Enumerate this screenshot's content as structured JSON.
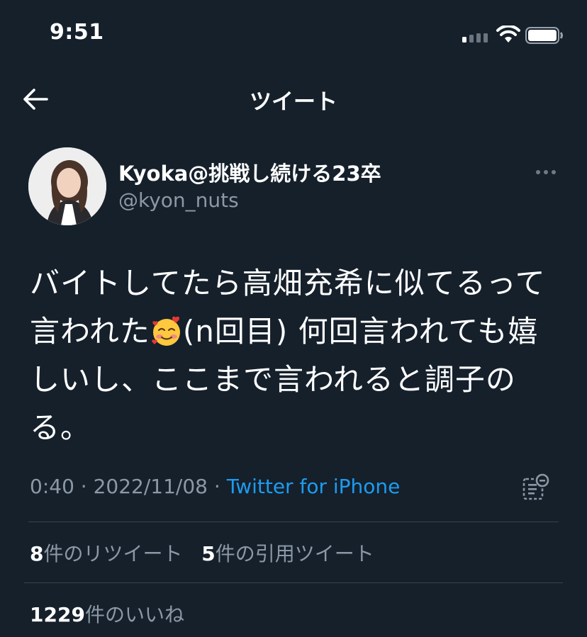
{
  "status_bar": {
    "time": "9:51"
  },
  "header": {
    "title": "ツイート"
  },
  "tweet": {
    "author": {
      "display_name": "Kyoka@挑戦し続ける23卒",
      "handle": "@kyon_nuts"
    },
    "text_before_emoji": "バイトしてたら高畑充希に似てるって言われた",
    "emoji": "smiling-face-with-hearts",
    "text_after_emoji": "(n回目) 何回言われても嬉しいし、ここまで言われると調子のる。",
    "time": "0:40",
    "separator": "·",
    "date": "2022/11/08",
    "source": "Twitter for iPhone",
    "retweets": {
      "count": "8",
      "label": "件のリツイート"
    },
    "quotes": {
      "count": "5",
      "label": "件の引用ツイート"
    },
    "likes": {
      "count": "1229",
      "label": "件のいいね"
    }
  },
  "colors": {
    "background": "#15202b",
    "secondary_text": "#8b98a5",
    "link": "#1d9bf0",
    "divider": "#38444d"
  },
  "icons": [
    "back-arrow-icon",
    "more-icon",
    "analytics-icon",
    "signal-icon",
    "wifi-icon",
    "battery-icon"
  ]
}
